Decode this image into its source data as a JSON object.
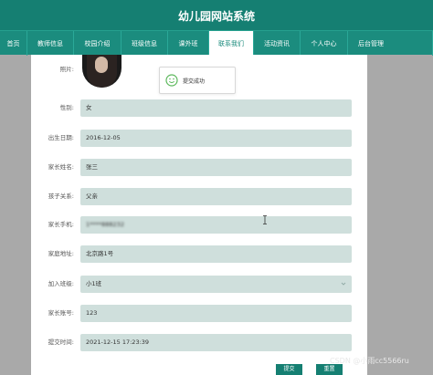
{
  "site": {
    "title": "幼儿园网站系统"
  },
  "nav": {
    "items": [
      {
        "label": "首页"
      },
      {
        "label": "教师信息"
      },
      {
        "label": "校园介绍"
      },
      {
        "label": "班级信息"
      },
      {
        "label": "课外班"
      },
      {
        "label": "联系我们"
      },
      {
        "label": "活动资讯"
      },
      {
        "label": "个人中心"
      },
      {
        "label": "后台管理"
      }
    ],
    "active_index": 5
  },
  "form": {
    "photo_label": "照片:",
    "fields": [
      {
        "label": "性别:",
        "value": "女"
      },
      {
        "label": "出生日期:",
        "value": "2016-12-05"
      },
      {
        "label": "家长姓名:",
        "value": "张三"
      },
      {
        "label": "孩子关系:",
        "value": "父亲"
      },
      {
        "label": "家长手机:",
        "value": "1****888232"
      },
      {
        "label": "家庭地址:",
        "value": "北京路1号"
      },
      {
        "label": "加入班级:",
        "value": "小1班"
      },
      {
        "label": "家长账号:",
        "value": "123"
      },
      {
        "label": "提交时间:",
        "value": "2021-12-15 17:23:39"
      }
    ]
  },
  "toast": {
    "text": "提交成功"
  },
  "buttons": {
    "submit": "提交",
    "reset": "重置"
  },
  "watermark": "CSDN @小雨cc5566ru",
  "colors": {
    "primary": "#157f72",
    "field_bg": "#cfdfdc",
    "backdrop": "#a9a9a9"
  }
}
